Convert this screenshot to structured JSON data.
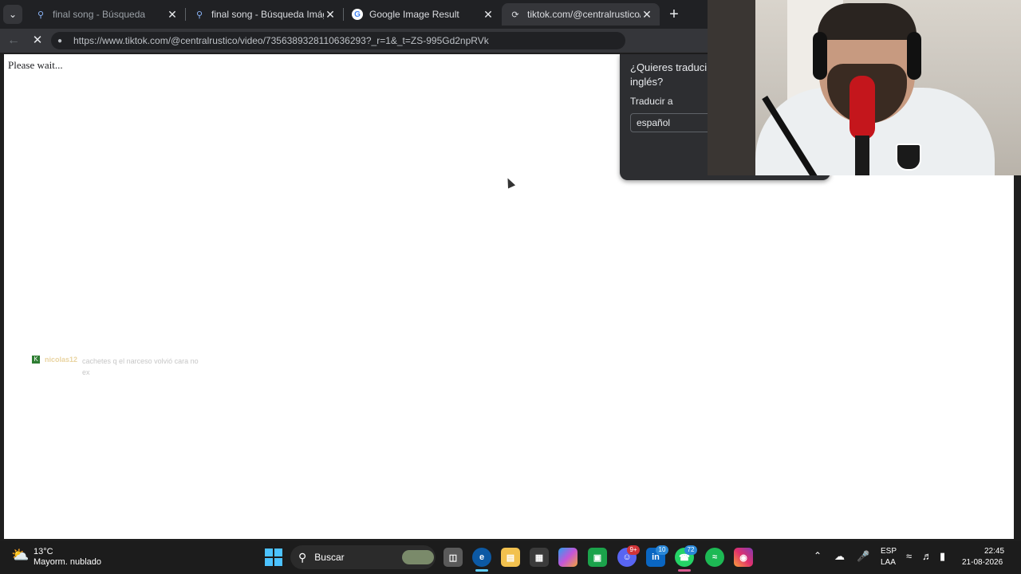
{
  "tabs": [
    {
      "title": "final song - Búsqueda",
      "favicon": "search-icon"
    },
    {
      "title": "final song - Búsqueda Imágenes",
      "favicon": "search-icon"
    },
    {
      "title": "Google Image Result",
      "favicon": "google-g-icon"
    },
    {
      "title": "tiktok.com/@centralrustico/video/",
      "favicon": "loading-spinner-icon"
    }
  ],
  "toolbar": {
    "url": "https://www.tiktok.com/@centralrustico/video/7356389328110636293?_r=1&_t=ZS-995Gd2npRVk"
  },
  "page": {
    "status_text": "Please wait..."
  },
  "translate_popup": {
    "question": "¿Quieres traducir inglés?",
    "question_line1": "¿Quieres traduci",
    "question_line2": "inglés?",
    "translate_to_label": "Traducir a",
    "language_value": "español"
  },
  "overlay_chat": {
    "username": "nicolas12",
    "message": "cachetes q el narceso volvió cara no ex"
  },
  "taskbar": {
    "weather_temp": "13°C",
    "weather_desc": "Mayorm. nublado",
    "search_label": "Buscar",
    "discord_badge": "9+",
    "linkedin_badge": "10",
    "whatsapp_badge": "72",
    "lang_line1": "ESP",
    "lang_line2": "LAA",
    "time": "22:45",
    "date": "21-08-2026"
  },
  "colors": {
    "chrome_dark": "#202124",
    "toolbar": "#35363a",
    "accent": "#4cc2ff"
  }
}
